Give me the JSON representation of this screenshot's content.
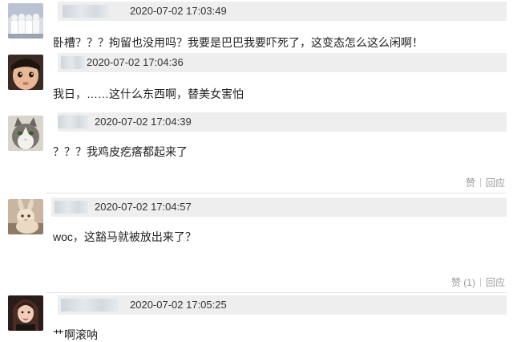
{
  "comments": [
    {
      "timestamp": "2020-07-02 17:03:49",
      "text": "卧槽？？？拘留也没用吗？我要是巴巴我要吓死了，这变态怎么这么闲啊！",
      "avatar_icon": "avatar-group-photo-icon"
    },
    {
      "timestamp": "2020-07-02 17:04:36",
      "text": "我日，……这什么东西啊，替美女害怕",
      "avatar_icon": "avatar-child-face-icon"
    },
    {
      "timestamp": "2020-07-02 17:04:39",
      "text": "？？？我鸡皮疙瘩都起来了",
      "avatar_icon": "avatar-cat-icon",
      "like_label": "赞",
      "reply_label": "回应"
    },
    {
      "timestamp": "2020-07-02 17:04:57",
      "text": "woc，这豁马就被放出来了？",
      "avatar_icon": "avatar-rabbit-icon",
      "like_label": "赞 (1)",
      "reply_label": "回应"
    },
    {
      "timestamp": "2020-07-02 17:05:25",
      "text": "艹啊滚呐",
      "avatar_icon": "avatar-woman-portrait-icon"
    }
  ],
  "colors": {
    "header_bar": "#eeeeee",
    "text": "#222222",
    "action_text": "#999999"
  }
}
